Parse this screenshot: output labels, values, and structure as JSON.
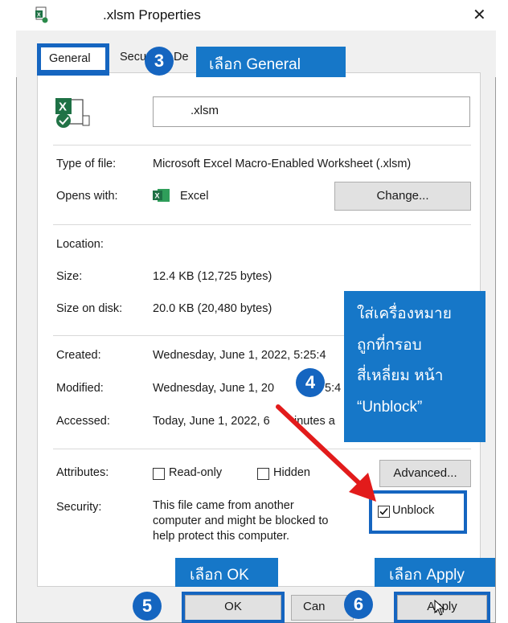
{
  "window": {
    "title": ".xlsm Properties",
    "close_glyph": "✕"
  },
  "tabs": {
    "general": "General",
    "security_partial": "Secu",
    "details_partial": "De"
  },
  "general": {
    "file_name": ".xlsm",
    "type_label": "Type of file:",
    "type_value": "Microsoft Excel Macro-Enabled Worksheet (.xlsm)",
    "opens_label": "Opens with:",
    "opens_value": "Excel",
    "change_button": "Change...",
    "location_label": "Location:",
    "size_label": "Size:",
    "size_value": "12.4 KB (12,725 bytes)",
    "size_disk_label": "Size on disk:",
    "size_disk_value": "20.0 KB (20,480 bytes)",
    "created_label": "Created:",
    "created_value": "Wednesday, June 1, 2022, 5:25:4",
    "modified_label": "Modified:",
    "modified_value": "Wednesday, June 1, 20",
    "modified_tail": "5:4",
    "accessed_label": "Accessed:",
    "accessed_value": "Today, June 1, 2022, 6",
    "accessed_tail": "inutes a",
    "attributes_label": "Attributes:",
    "readonly_label": "Read-only",
    "hidden_label": "Hidden",
    "advanced_button": "Advanced...",
    "security_label": "Security:",
    "security_text_1": "This file came from another",
    "security_text_2": "computer and might be blocked to",
    "security_text_3": "help protect this computer.",
    "unblock_label": "Unblock",
    "unblock_checked": true
  },
  "footer": {
    "ok_button": "OK",
    "cancel_button": "Can",
    "apply_button": "Apply"
  },
  "annotations": {
    "step3_number": "3",
    "step3_text": "เลือก General",
    "step4_number": "4",
    "step4_line1": "ใส่เครื่องหมาย",
    "step4_line2": "ถูกที่กรอบ",
    "step4_line3": "สี่เหลี่ยม หน้า",
    "step4_line4": "“Unblock”",
    "step5_number": "5",
    "step5_text": "เลือก OK",
    "step6_number": "6",
    "step6_text": "เลือก Apply",
    "accent_color": "#1565c0",
    "arrow_color": "#e21b1b"
  }
}
